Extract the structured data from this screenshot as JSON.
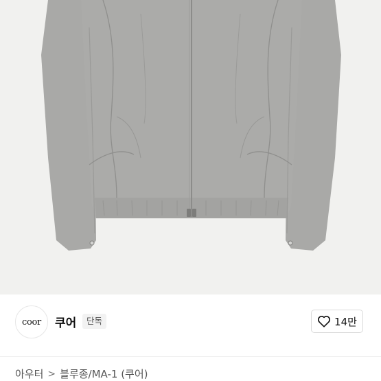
{
  "product": {
    "image_alt_icon": "jacket-image",
    "colors": {
      "garment": "#a8a8a6",
      "seam": "#8e8e8c",
      "background": "#f1f1ef"
    }
  },
  "brand": {
    "logo_text": "coor",
    "name": "쿠어",
    "badge": "단독"
  },
  "like": {
    "icon": "heart-icon",
    "count": "14만"
  },
  "breadcrumb": {
    "items": [
      "아우터",
      "블루종/MA-1 (쿠어)"
    ],
    "separator": ">"
  }
}
